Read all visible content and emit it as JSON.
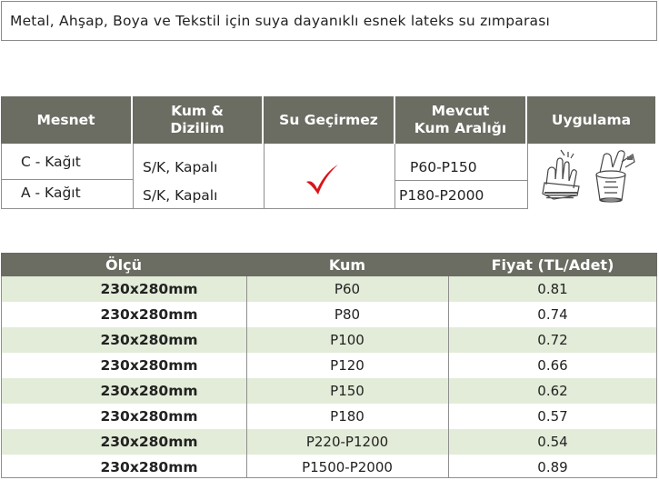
{
  "title": "Metal, Ahşap, Boya ve Tekstil için suya dayanıklı esnek lateks su zımparası",
  "spec_table": {
    "headers": [
      "Mesnet",
      "Kum & Dizilim",
      "Su Geçirmez",
      "Mevcut Kum Aralığı",
      "Uygulama"
    ],
    "rows": [
      {
        "backing": "C - Kağıt",
        "grit_coat": "S/K, Kapalı",
        "grit_range": "P60-P150"
      },
      {
        "backing": "A - Kağıt",
        "grit_coat": "S/K, Kapalı",
        "grit_range": "P180-P2000"
      }
    ],
    "waterproof_icon": "check-icon",
    "application_icons": [
      "hand-sanding-icon",
      "paint-bucket-sanding-icon"
    ]
  },
  "price_table": {
    "headers": [
      "Ölçü",
      "Kum",
      "Fiyat (TL/Adet)"
    ],
    "rows": [
      {
        "size": "230x280mm",
        "grit": "P60",
        "price": "0.81"
      },
      {
        "size": "230x280mm",
        "grit": "P80",
        "price": "0.74"
      },
      {
        "size": "230x280mm",
        "grit": "P100",
        "price": "0.72"
      },
      {
        "size": "230x280mm",
        "grit": "P120",
        "price": "0.66"
      },
      {
        "size": "230x280mm",
        "grit": "P150",
        "price": "0.62"
      },
      {
        "size": "230x280mm",
        "grit": "P180",
        "price": "0.57"
      },
      {
        "size": "230x280mm",
        "grit": "P220-P1200",
        "price": "0.54"
      },
      {
        "size": "230x280mm",
        "grit": "P1500-P2000",
        "price": "0.89"
      }
    ]
  },
  "colors": {
    "header_bg": "#6b6c62",
    "row_shade": "#e3ecd8",
    "check": "#d9141b"
  }
}
